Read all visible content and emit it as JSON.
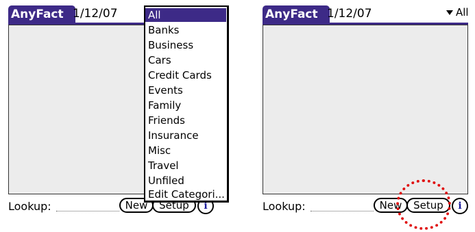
{
  "left": {
    "app_title": "AnyFact",
    "date": "1/12/07",
    "lookup_label": "Lookup:",
    "new_label": "New",
    "setup_label": "Setup",
    "info_label": "i",
    "dropdown": {
      "selected": "All",
      "items": [
        "All",
        "Banks",
        "Business",
        "Cars",
        "Credit Cards",
        "Events",
        "Family",
        "Friends",
        "Insurance",
        "Misc",
        "Travel",
        "Unfiled",
        "Edit Categori..."
      ]
    }
  },
  "right": {
    "app_title": "AnyFact",
    "date": "1/12/07",
    "category": "All",
    "lookup_label": "Lookup:",
    "new_label": "New",
    "setup_label": "Setup",
    "info_label": "i"
  },
  "colors": {
    "title_bar": "#3d2a87",
    "highlight": "#e01010",
    "list_bg": "#ececec"
  },
  "icons": {
    "category_arrow": "triangle-down-icon",
    "info": "info-icon"
  }
}
